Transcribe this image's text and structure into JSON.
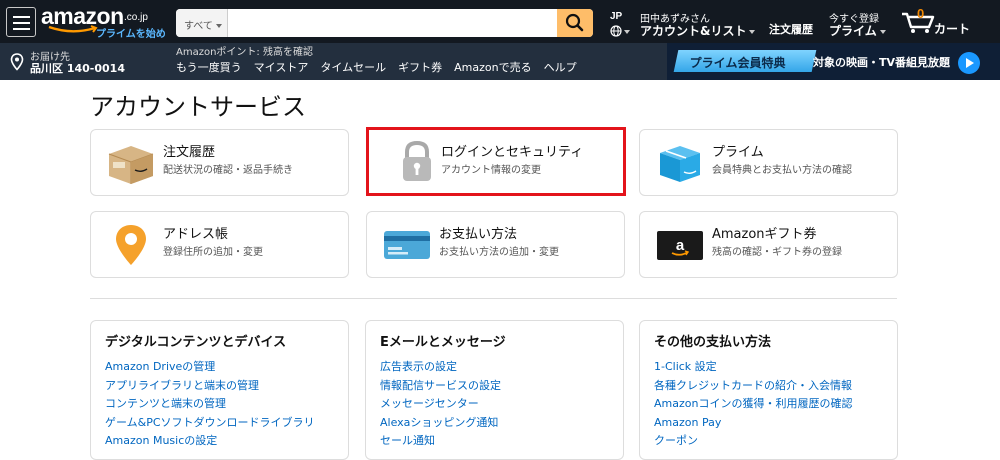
{
  "header": {
    "logo_text": "amazon",
    "logo_tld": ".co.jp",
    "logo_prime": "プライムを始める",
    "search": {
      "category": "すべて",
      "value": "",
      "placeholder": ""
    },
    "lang_code": "JP",
    "account": {
      "greeting": "田中あずみさん",
      "label": "アカウント&リスト"
    },
    "orders_label": "注文履歴",
    "prime": {
      "line1": "今すぐ登録",
      "line2": "プライム"
    },
    "cart": {
      "count": "0",
      "label": "カート"
    }
  },
  "subnav": {
    "deliver_line1": "お届け先",
    "deliver_line2": "品川区 140-0014",
    "points": "Amazonポイント: 残高を確認",
    "links": [
      "もう一度買う",
      "マイストア",
      "タイムセール",
      "ギフト券",
      "Amazonで売る",
      "ヘルプ"
    ],
    "prime_benefit": "プライム会員特典",
    "prime_watch": "対象の映画・TV番組見放題"
  },
  "page": {
    "title": "アカウントサービス"
  },
  "cards": [
    {
      "title": "注文履歴",
      "sub": "配送状況の確認・返品手続き",
      "icon": "package-icon"
    },
    {
      "title": "ログインとセキュリティ",
      "sub": "アカウント情報の変更",
      "icon": "lock-icon"
    },
    {
      "title": "プライム",
      "sub": "会員特典とお支払い方法の確認",
      "icon": "prime-box-icon"
    },
    {
      "title": "アドレス帳",
      "sub": "登録住所の追加・変更",
      "icon": "map-pin-icon"
    },
    {
      "title": "お支払い方法",
      "sub": "お支払い方法の追加・変更",
      "icon": "credit-card-icon"
    },
    {
      "title": "Amazonギフト券",
      "sub": "残高の確認・ギフト券の登録",
      "icon": "gift-card-icon"
    }
  ],
  "sections": [
    {
      "title": "デジタルコンテンツとデバイス",
      "links": [
        "Amazon Driveの管理",
        "アプリライブラリと端末の管理",
        "コンテンツと端末の管理",
        "ゲーム&PCソフトダウンロードライブラリ",
        "Amazon Musicの設定"
      ]
    },
    {
      "title": "Eメールとメッセージ",
      "links": [
        "広告表示の設定",
        "情報配信サービスの設定",
        "メッセージセンター",
        "Alexaショッピング通知",
        "セール通知"
      ]
    },
    {
      "title": "その他の支払い方法",
      "links": [
        "1-Click 設定",
        "各種クレジットカードの紹介・入会情報",
        "Amazonコインの獲得・利用履歴の確認",
        "Amazon Pay",
        "クーポン"
      ]
    }
  ],
  "colors": {
    "nav_bg": "#131921",
    "subnav_bg": "#232f3e",
    "search_btn": "#febd69",
    "link": "#0066c0",
    "highlight": "#e3141b",
    "cart_count": "#f08804"
  }
}
